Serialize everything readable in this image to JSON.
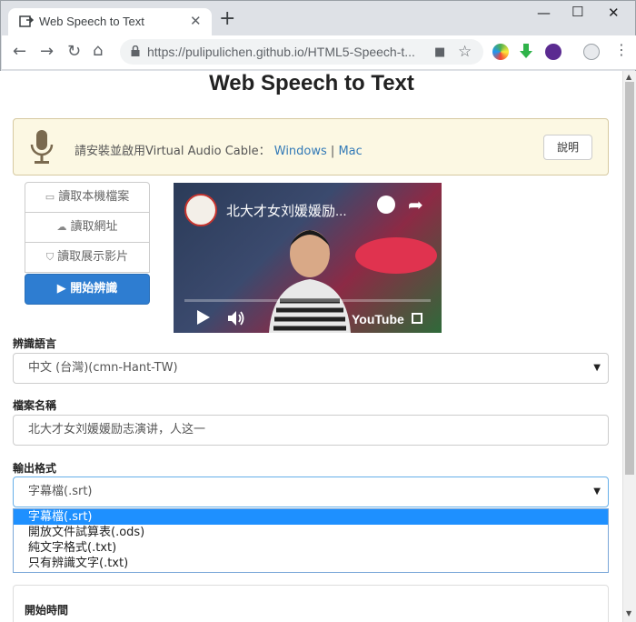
{
  "browser": {
    "tab_title": "Web Speech to Text",
    "url": "https://pulipulichen.github.io/HTML5-Speech-t..."
  },
  "page": {
    "heading": "Web Speech to Text",
    "alert": {
      "message": "請安裝並啟用Virtual Audio Cable：",
      "link_windows": "Windows",
      "separator": " | ",
      "link_mac": "Mac",
      "help_button": "說明"
    },
    "sources": {
      "local_file": "讀取本機檔案",
      "url": "讀取網址",
      "demo_video": "讀取展示影片",
      "start": "開始辨識"
    },
    "video": {
      "title": "北大才女刘媛媛励...",
      "brand": "YouTube"
    },
    "language": {
      "label": "辨識語言",
      "value": "中文 (台灣)(cmn-Hant-TW)"
    },
    "filename": {
      "label": "檔案名稱",
      "value": "北大才女刘媛媛励志演讲，人这一"
    },
    "output_format": {
      "label": "輸出格式",
      "value": "字幕檔(.srt)",
      "options": [
        "字幕檔(.srt)",
        "開放文件試算表(.ods)",
        "純文字格式(.txt)",
        "只有辨識文字(.txt)"
      ]
    },
    "start_time": {
      "label": "開始時間"
    }
  },
  "colors": {
    "primary": "#2e7dd1",
    "alert_bg": "#fcf8e3",
    "link": "#337ab7",
    "selected_option": "#1e90ff"
  }
}
